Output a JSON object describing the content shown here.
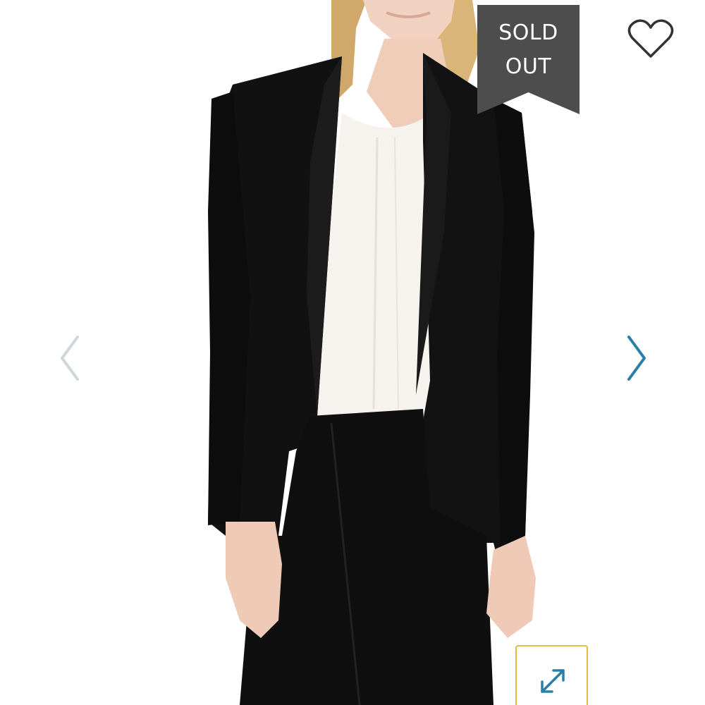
{
  "badge": {
    "line1": "SOLD",
    "line2": "OUT",
    "color": "#4d4d4d"
  },
  "icons": {
    "wishlist": "heart-outline-icon",
    "previous": "chevron-left-icon",
    "next": "chevron-right-icon",
    "expand": "expand-diagonal-icon"
  },
  "colors": {
    "accent": "#2a7fa8",
    "expand_border": "#e6b93f",
    "arrow_inactive": "#cfd6da"
  }
}
